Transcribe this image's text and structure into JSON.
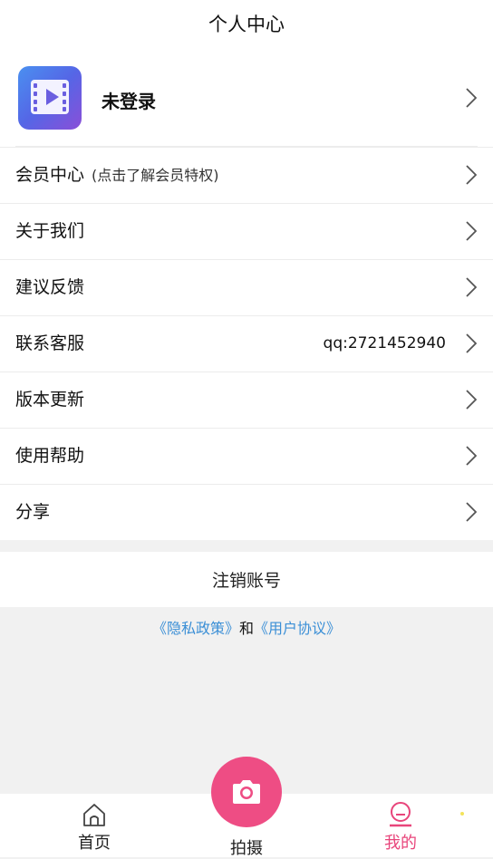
{
  "header": {
    "title": "个人中心"
  },
  "profile": {
    "name": "未登录",
    "avatar_icon": "video-app-icon"
  },
  "menu": [
    {
      "label": "会员中心",
      "sub": "(点击了解会员特权)",
      "right": ""
    },
    {
      "label": "关于我们",
      "sub": "",
      "right": ""
    },
    {
      "label": "建议反馈",
      "sub": "",
      "right": ""
    },
    {
      "label": "联系客服",
      "sub": "",
      "right": "qq:2721452940"
    },
    {
      "label": "版本更新",
      "sub": "",
      "right": ""
    },
    {
      "label": "使用帮助",
      "sub": "",
      "right": ""
    },
    {
      "label": "分享",
      "sub": "",
      "right": ""
    }
  ],
  "logout": {
    "label": "注销账号"
  },
  "policy": {
    "privacy": "《隐私政策》",
    "and": "和",
    "agreement": "《用户协议》"
  },
  "tabbar": {
    "home": "首页",
    "shoot": "拍摄",
    "me": "我的"
  },
  "colors": {
    "accent": "#ee4d84",
    "link": "#3b8fd6",
    "active_tab": "#e8457b"
  }
}
